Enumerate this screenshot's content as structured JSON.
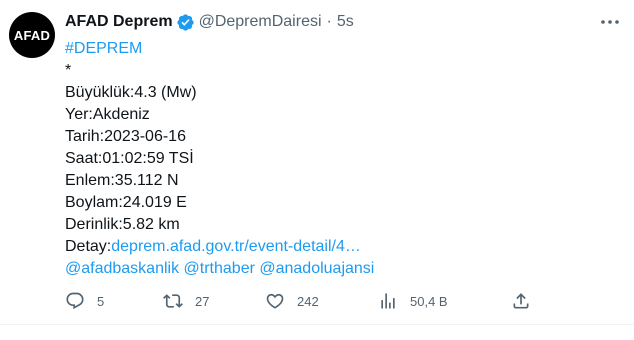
{
  "author": {
    "avatar_text": "AFAD",
    "display_name": "AFAD Deprem",
    "handle": "@DepremDairesi",
    "separator": "·",
    "time": "5s"
  },
  "body": {
    "hashtag": "#DEPREM",
    "star": "*",
    "magnitude": "Büyüklük:4.3 (Mw)",
    "place": "Yer:Akdeniz",
    "date": "Tarih:2023-06-16",
    "time": "Saat:01:02:59 TSİ",
    "latitude": "Enlem:35.112 N",
    "longitude": "Boylam:24.019 E",
    "depth": "Derinlik:5.82 km",
    "detail_label": "Detay:",
    "detail_link": "deprem.afad.gov.tr/event-detail/4…",
    "mentions": "@afadbaskanlik @trthaber @anadoluajansi"
  },
  "actions": {
    "reply_count": "5",
    "retweet_count": "27",
    "like_count": "242",
    "view_count": "50,4 B"
  },
  "icons": {
    "verified": "verified-badge-icon",
    "more": "more-dots-icon",
    "reply": "reply-icon",
    "retweet": "retweet-icon",
    "like": "heart-icon",
    "views": "views-icon",
    "share": "share-icon"
  },
  "colors": {
    "accent": "#1d9bf0",
    "secondary_text": "#536471",
    "primary_text": "#0f1419",
    "avatar_bg": "#000000"
  }
}
